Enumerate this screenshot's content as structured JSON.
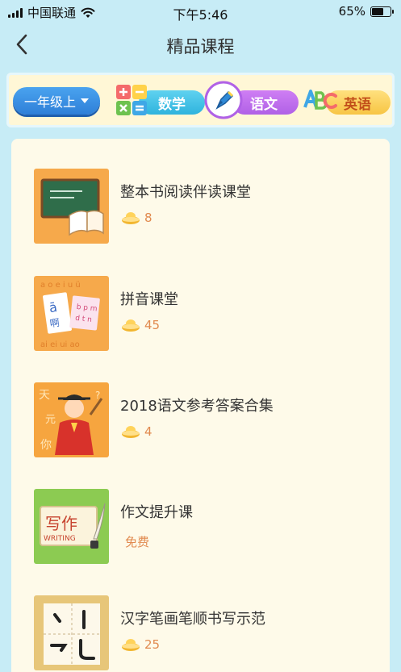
{
  "status_bar": {
    "carrier": "中国联通",
    "time": "下午5:46",
    "battery": "65%",
    "battery_level": 0.65
  },
  "nav": {
    "title": "精品课程"
  },
  "subjects": {
    "grade": "一年级上",
    "tabs": [
      {
        "label": "数学",
        "icon": "math-icon"
      },
      {
        "label": "语文",
        "icon": "pen-icon",
        "selected": true
      },
      {
        "label": "英语",
        "icon": "abc-icon"
      }
    ]
  },
  "courses": [
    {
      "title": "整本书阅读伴读课堂",
      "price": "8",
      "thumb": "chalkboard-book"
    },
    {
      "title": "拼音课堂",
      "price": "45",
      "thumb": "pinyin-cards"
    },
    {
      "title": "2018语文参考答案合集",
      "price": "4",
      "thumb": "scholar"
    },
    {
      "title": "作文提升课",
      "price_text": "免费",
      "thumb": "writing-scroll"
    },
    {
      "title": "汉字笔画笔顺书写示范",
      "price": "25",
      "thumb": "stroke-grid"
    }
  ],
  "colors": {
    "background": "#c7ecf6",
    "price": "#e18a4f",
    "chinese_tab": "#b061e6",
    "math_tab": "#2fb3dd",
    "english_tab": "#f7c544",
    "grade": "#2e7fd8"
  }
}
